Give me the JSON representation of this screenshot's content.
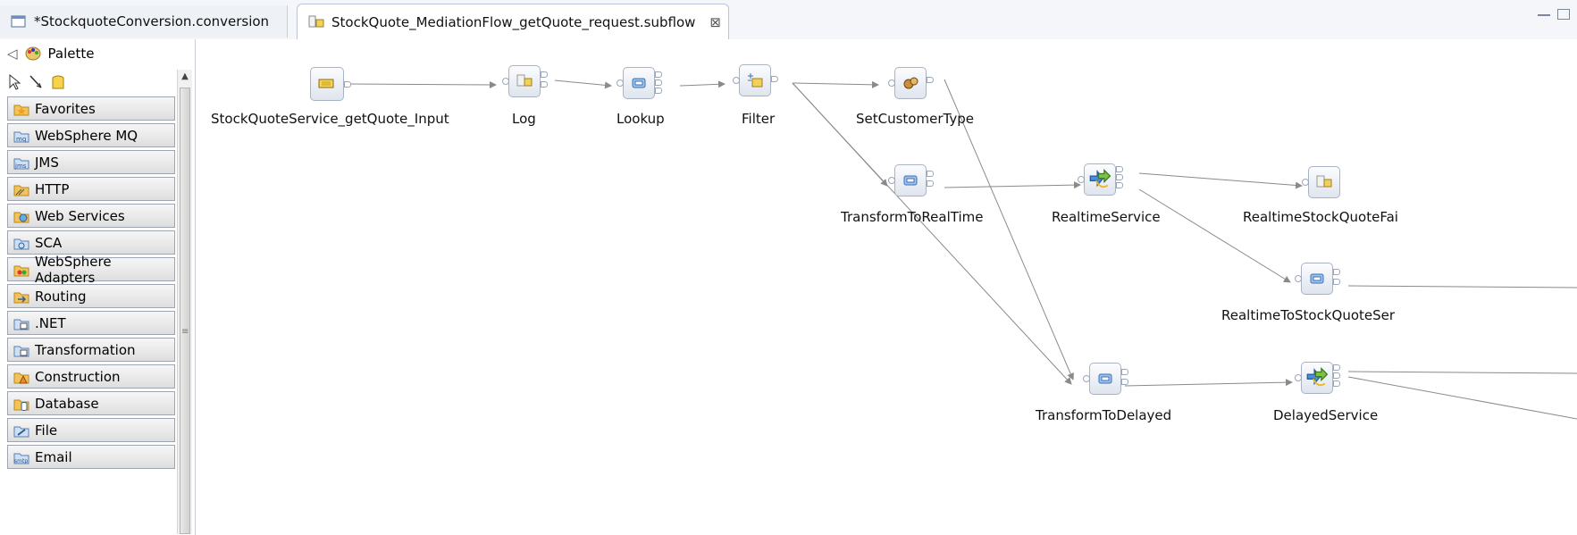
{
  "tabs": [
    {
      "label": "*StockquoteConversion.conversion"
    },
    {
      "label": "StockQuote_MediationFlow_getQuote_request.subflow"
    }
  ],
  "palette": {
    "title": "Palette",
    "drawers": [
      {
        "label": "Favorites"
      },
      {
        "label": "WebSphere MQ"
      },
      {
        "label": "JMS"
      },
      {
        "label": "HTTP"
      },
      {
        "label": "Web Services"
      },
      {
        "label": "SCA"
      },
      {
        "label": "WebSphere Adapters"
      },
      {
        "label": "Routing"
      },
      {
        "label": ".NET"
      },
      {
        "label": "Transformation"
      },
      {
        "label": "Construction"
      },
      {
        "label": "Database"
      },
      {
        "label": "File"
      },
      {
        "label": "Email"
      }
    ]
  },
  "flow": {
    "nodes": [
      {
        "label": "StockQuoteService_getQuote_Input",
        "icon": "input-node-icon"
      },
      {
        "label": "Log",
        "icon": "log-icon"
      },
      {
        "label": "Lookup",
        "icon": "mapping-icon"
      },
      {
        "label": "Filter",
        "icon": "filter-icon"
      },
      {
        "label": "SetCustomerType",
        "icon": "custom-icon"
      },
      {
        "label": "TransformToRealTime",
        "icon": "mapping-icon"
      },
      {
        "label": "RealtimeService",
        "icon": "service-invoke-icon"
      },
      {
        "label": "RealtimeStockQuoteFai",
        "icon": "log-icon"
      },
      {
        "label": "RealtimeToStockQuoteSer",
        "icon": "mapping-icon"
      },
      {
        "label": "TransformToDelayed",
        "icon": "mapping-icon"
      },
      {
        "label": "DelayedService",
        "icon": "service-invoke-icon"
      }
    ]
  },
  "colors": {
    "accent": "#3c6fb6",
    "wire": "#7d7d7d",
    "drawer_border": "#9ea5b1"
  }
}
